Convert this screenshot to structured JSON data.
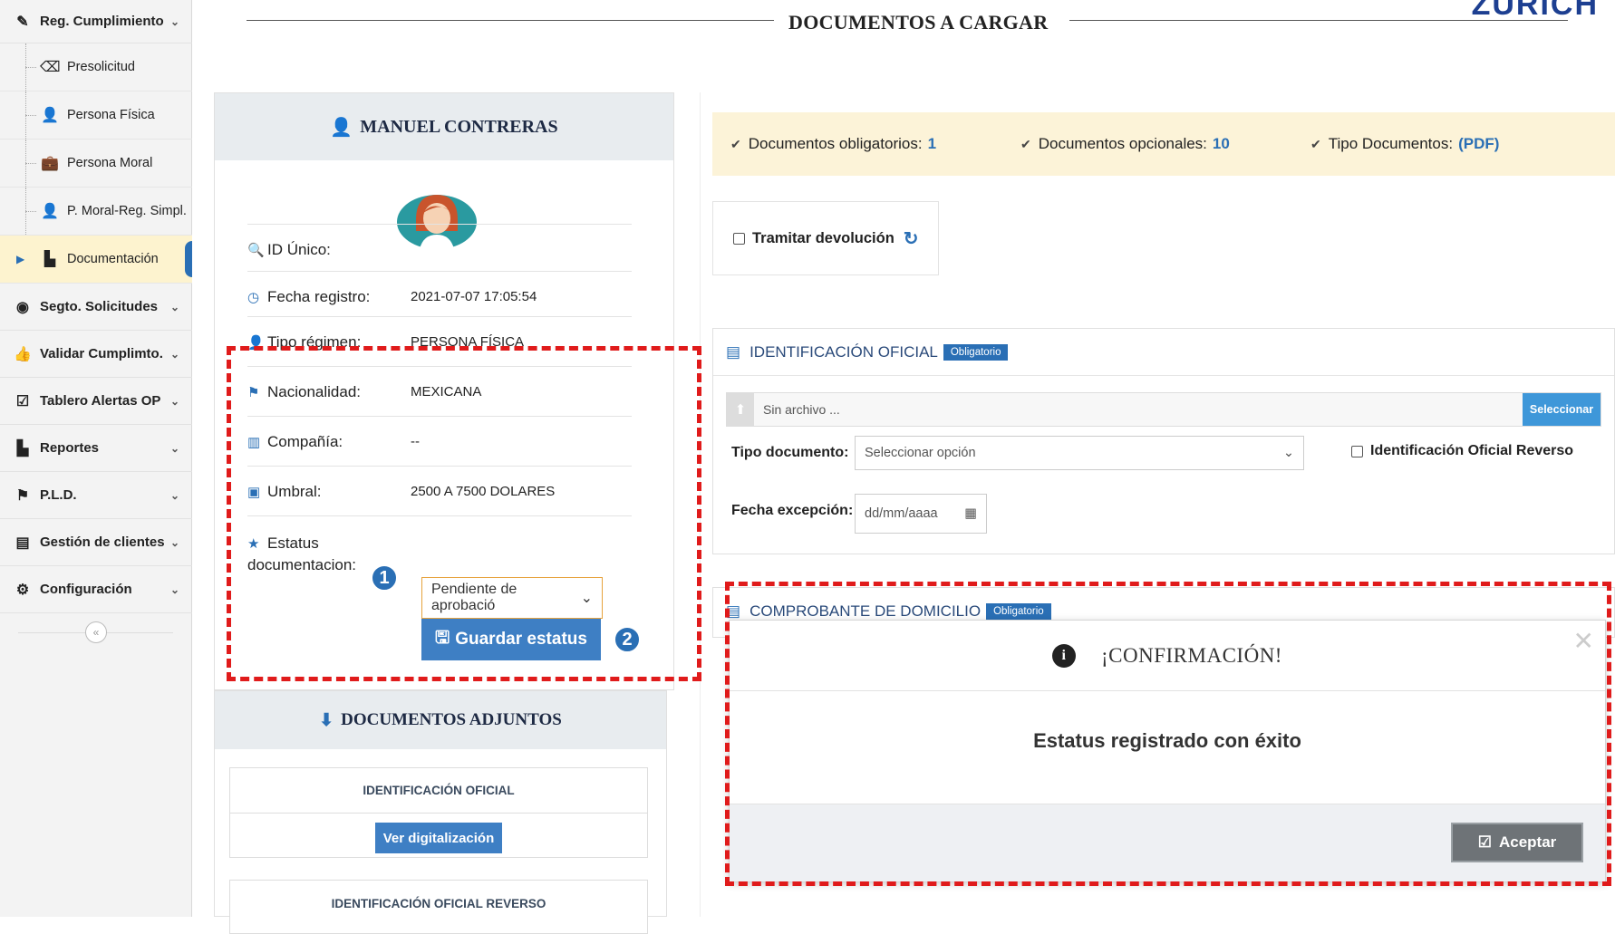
{
  "brand": "ZURICH",
  "page_title": "DOCUMENTOS A CARGAR",
  "sidebar": {
    "items": [
      {
        "label": "Reg. Cumplimiento",
        "type": "top",
        "icon": "pencil-icon"
      },
      {
        "label": "Presolicitud",
        "type": "sub",
        "icon": "eraser-icon"
      },
      {
        "label": "Persona Física",
        "type": "sub",
        "icon": "user-icon"
      },
      {
        "label": "Persona Moral",
        "type": "sub",
        "icon": "briefcase-icon"
      },
      {
        "label": "P. Moral-Reg. Simpl.",
        "type": "sub",
        "icon": "user-icon"
      },
      {
        "label": "Documentación",
        "type": "sub",
        "icon": "file-icon",
        "active": true
      },
      {
        "label": "Segto. Solicitudes",
        "type": "top",
        "icon": "eye-icon"
      },
      {
        "label": "Validar Cumplimto.",
        "type": "top",
        "icon": "thumbs-up-icon"
      },
      {
        "label": "Tablero Alertas OP",
        "type": "top",
        "icon": "check-square-icon"
      },
      {
        "label": "Reportes",
        "type": "top",
        "icon": "file-icon"
      },
      {
        "label": "P.L.D.",
        "type": "top",
        "icon": "flag-icon"
      },
      {
        "label": "Gestión de clientes",
        "type": "top",
        "icon": "list-icon"
      },
      {
        "label": "Configuración",
        "type": "top",
        "icon": "gears-icon"
      }
    ]
  },
  "profile": {
    "name": "MANUEL CONTRERAS",
    "rows": [
      {
        "label": "ID Único:",
        "value": "",
        "icon": "key-icon"
      },
      {
        "label": "Fecha registro:",
        "value": "2021-07-07 17:05:54",
        "icon": "clock-icon"
      },
      {
        "label": "Tipo régimen:",
        "value": "PERSONA FÍSICA",
        "icon": "user-icon"
      },
      {
        "label": "Nacionalidad:",
        "value": "MEXICANA",
        "icon": "flag-icon"
      },
      {
        "label": "Compañía:",
        "value": "--",
        "icon": "building-icon"
      },
      {
        "label": "Umbral:",
        "value": "2500 A 7500 DOLARES",
        "icon": "money-icon"
      }
    ],
    "status_label_1": "Estatus",
    "status_label_2": "documentacion:",
    "status_value": "Pendiente de aprobació",
    "save_label": "Guardar estatus",
    "step1": "1",
    "step2": "2"
  },
  "adjuntos": {
    "title": "DOCUMENTOS ADJUNTOS",
    "cards": [
      {
        "title": "IDENTIFICACIÓN OFICIAL",
        "button": "Ver digitalización"
      },
      {
        "title": "IDENTIFICACIÓN OFICIAL REVERSO"
      }
    ]
  },
  "info": {
    "oblig_label": "Documentos obligatorios:",
    "oblig_value": "1",
    "opc_label": "Documentos opcionales:",
    "opc_value": "10",
    "tipo_label": "Tipo Documentos:",
    "tipo_value": "(PDF)"
  },
  "tramitar": "Tramitar devolución",
  "sections": [
    {
      "title": "IDENTIFICACIÓN OFICIAL",
      "badge": "Obligatorio",
      "file_placeholder": "Sin archivo ...",
      "select_btn": "Seleccionar",
      "tipo_label": "Tipo documento:",
      "tipo_placeholder": "Seleccionar opción",
      "reverso_label": "Identificación Oficial Reverso",
      "fecha_label": "Fecha excepción:",
      "fecha_placeholder": "dd/mm/aaaa"
    },
    {
      "title": "COMPROBANTE DE DOMICILIO",
      "badge": "Obligatorio"
    }
  ],
  "modal": {
    "title": "¡CONFIRMACIÓN!",
    "message": "Estatus registrado con éxito",
    "ok_label": "Aceptar"
  },
  "colors": {
    "accent": "#2a6fb5",
    "highlight": "#e01b1b",
    "info_bg": "#fcf3d8"
  }
}
